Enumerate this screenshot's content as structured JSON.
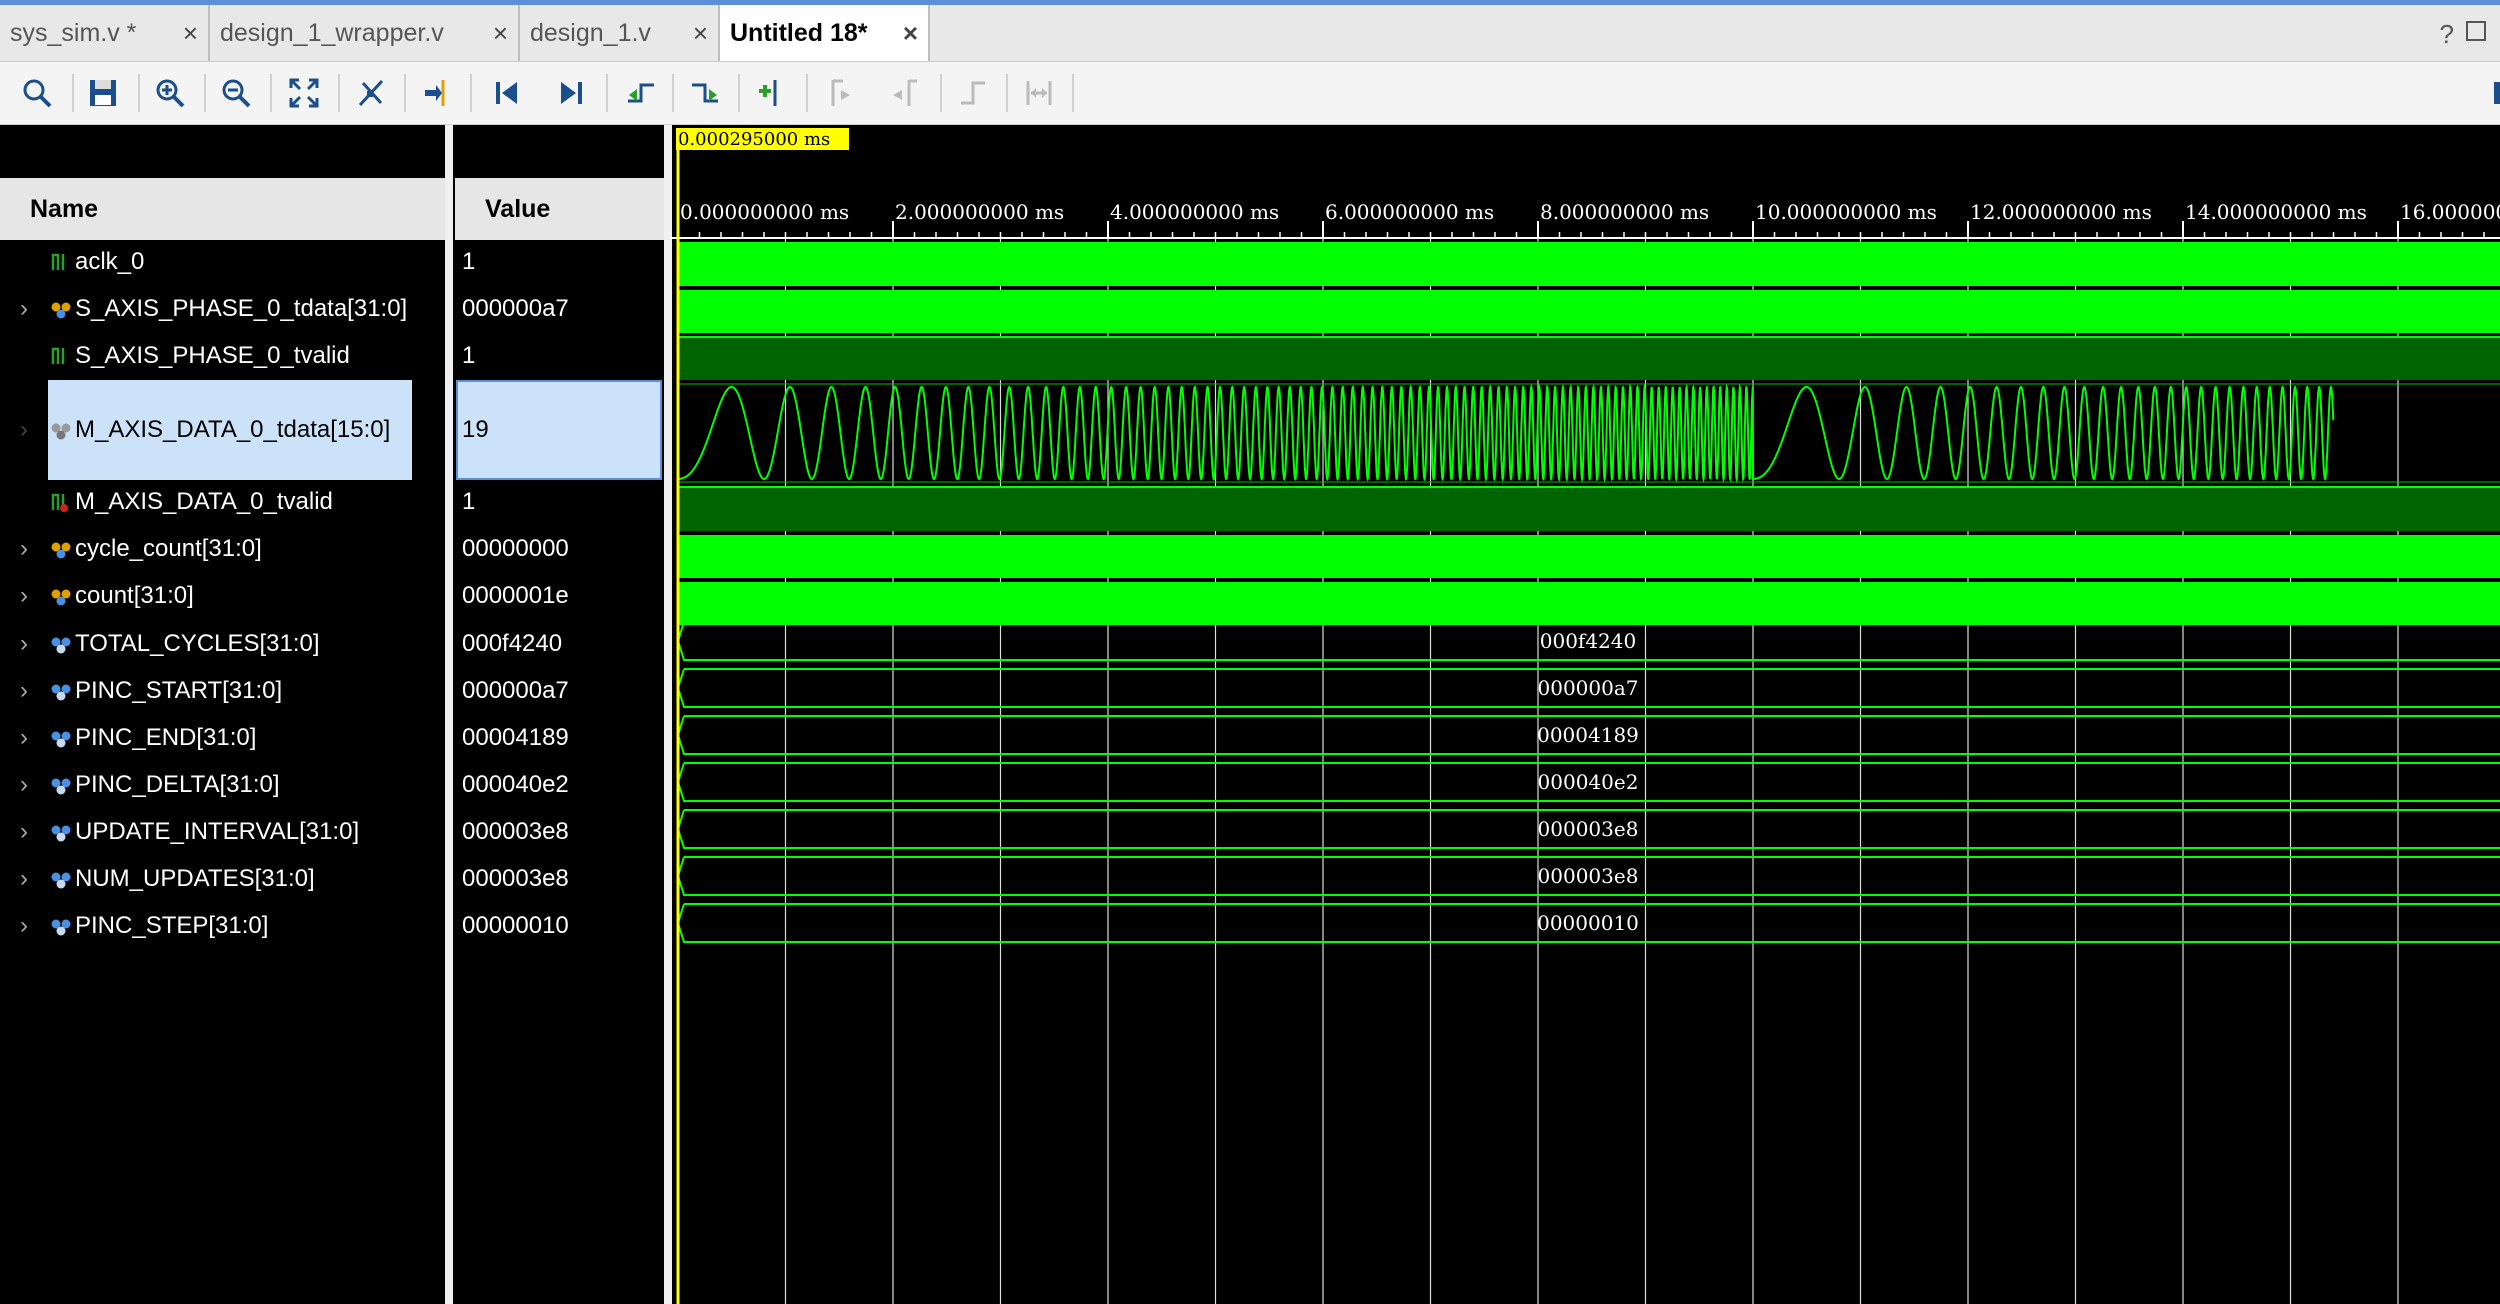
{
  "tabs": [
    {
      "label": "sys_sim.v *",
      "active": false
    },
    {
      "label": "design_1_wrapper.v",
      "active": false
    },
    {
      "label": "design_1.v",
      "active": false
    },
    {
      "label": "Untitled 18*",
      "active": true
    }
  ],
  "tab_close_glyph": "×",
  "help_glyph": "?",
  "toolbar_icons": [
    "search-icon",
    "save-icon",
    "zoom-in-icon",
    "zoom-out-icon",
    "zoom-fit-icon",
    "cursor-icon",
    "go-to-cursor-icon",
    "go-to-start-icon",
    "go-to-end-icon",
    "previous-transition-icon",
    "next-transition-icon",
    "add-marker-icon",
    "previous-marker-icon",
    "next-marker-icon",
    "swap-cursors-icon",
    "snap-transition-icon"
  ],
  "columns": {
    "name": "Name",
    "value": "Value"
  },
  "signals": [
    {
      "name": "aclk_0",
      "value": "1",
      "kind": "bit",
      "expandable": false
    },
    {
      "name": "S_AXIS_PHASE_0_tdata[31:0]",
      "value": "000000a7",
      "kind": "bus-active",
      "expandable": true
    },
    {
      "name": "S_AXIS_PHASE_0_tvalid",
      "value": "1",
      "kind": "bit",
      "expandable": false
    },
    {
      "name": "M_AXIS_DATA_0_tdata[15:0]",
      "value": "19",
      "kind": "analog",
      "expandable": true,
      "selected": true
    },
    {
      "name": "M_AXIS_DATA_0_tvalid",
      "value": "1",
      "kind": "bit-red",
      "expandable": false
    },
    {
      "name": "cycle_count[31:0]",
      "value": "00000000",
      "kind": "bus-active",
      "expandable": true
    },
    {
      "name": "count[31:0]",
      "value": "0000001e",
      "kind": "bus-active",
      "expandable": true
    },
    {
      "name": "TOTAL_CYCLES[31:0]",
      "value": "000f4240",
      "kind": "param",
      "expandable": true
    },
    {
      "name": "PINC_START[31:0]",
      "value": "000000a7",
      "kind": "param",
      "expandable": true
    },
    {
      "name": "PINC_END[31:0]",
      "value": "00004189",
      "kind": "param",
      "expandable": true
    },
    {
      "name": "PINC_DELTA[31:0]",
      "value": "000040e2",
      "kind": "param",
      "expandable": true
    },
    {
      "name": "UPDATE_INTERVAL[31:0]",
      "value": "000003e8",
      "kind": "param",
      "expandable": true
    },
    {
      "name": "NUM_UPDATES[31:0]",
      "value": "000003e8",
      "kind": "param",
      "expandable": true
    },
    {
      "name": "PINC_STEP[31:0]",
      "value": "00000010",
      "kind": "param",
      "expandable": true
    }
  ],
  "cursor_time": "0.000295000 ms",
  "time_ticks": [
    "0.000000000 ms",
    "2.000000000 ms",
    "4.000000000 ms",
    "6.000000000 ms",
    "8.000000000 ms",
    "10.000000000 ms",
    "12.000000000 ms",
    "14.000000000 ms",
    "16.000000"
  ],
  "colors": {
    "wave_bright": "#00ff00",
    "wave_dark": "#006400",
    "cursor": "#ffff00",
    "selection": "#cce2f8",
    "accent": "#5b8fd6"
  }
}
